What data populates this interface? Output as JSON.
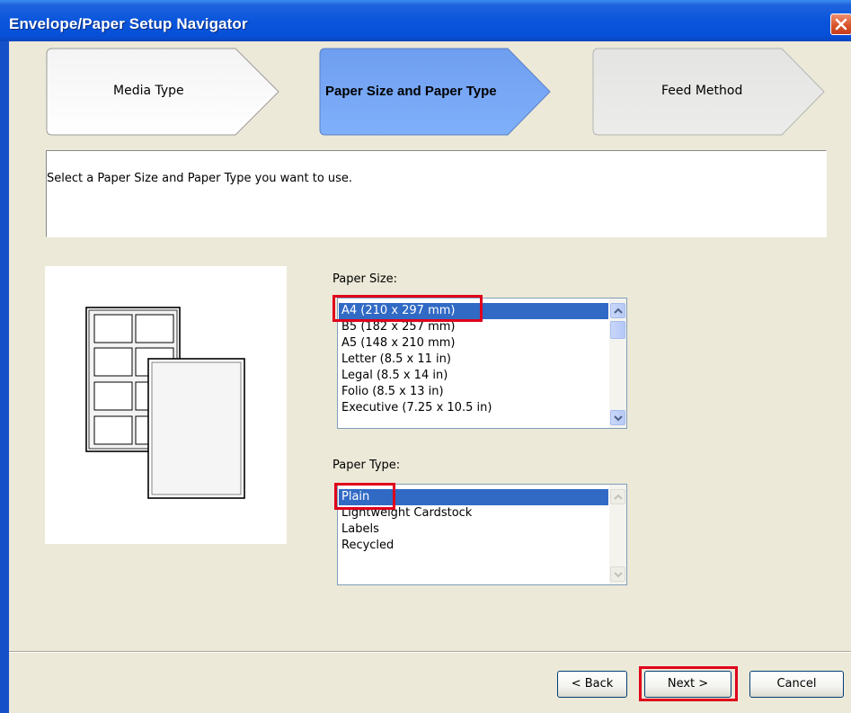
{
  "window": {
    "title": "Envelope/Paper Setup Navigator"
  },
  "steps": [
    {
      "label": "Media Type",
      "state": "done"
    },
    {
      "label": "Paper Size and Paper Type",
      "state": "active"
    },
    {
      "label": "Feed Method",
      "state": "pending"
    }
  ],
  "instruction": "Select a Paper Size and Paper Type you want to use.",
  "paper_size": {
    "label": "Paper Size:",
    "options": [
      "A4 (210 x 297 mm)",
      "B5 (182 x 257 mm)",
      "A5 (148 x 210 mm)",
      "Letter (8.5 x 11 in)",
      "Legal (8.5 x 14 in)",
      "Folio (8.5 x 13 in)",
      "Executive (7.25 x 10.5 in)"
    ],
    "selected": "A4 (210 x 297 mm)"
  },
  "paper_type": {
    "label": "Paper Type:",
    "options": [
      "Plain",
      "Lightweight Cardstock",
      "Labels",
      "Recycled"
    ],
    "selected": "Plain"
  },
  "buttons": {
    "back": "< Back",
    "next": "Next >",
    "cancel": "Cancel"
  },
  "colors": {
    "title_bar": "#0a55dc",
    "selection": "#316ac5",
    "active_step": "#6f9ef0",
    "highlight": "#e0001b"
  },
  "icons": {
    "close": "close-icon",
    "scroll_up": "scroll-up-arrow-icon",
    "scroll_down": "scroll-down-arrow-icon",
    "preview": "paper-labels-preview-icon"
  }
}
